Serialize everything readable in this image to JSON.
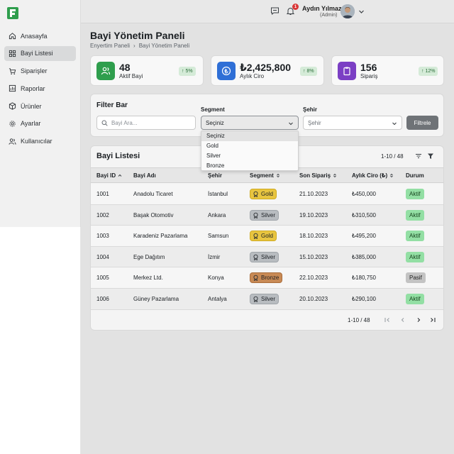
{
  "app": {
    "logo": "brand-logo"
  },
  "sidebar": {
    "items": [
      {
        "label": "Anasayfa",
        "icon": "home-icon"
      },
      {
        "label": "Bayi Listesi",
        "icon": "grid-icon",
        "active": true
      },
      {
        "label": "Siparişler",
        "icon": "cart-icon"
      },
      {
        "label": "Raporlar",
        "icon": "chart-icon"
      },
      {
        "label": "Ürünler",
        "icon": "box-icon"
      },
      {
        "label": "Ayarlar",
        "icon": "gear-icon"
      },
      {
        "label": "Kullanıcılar",
        "icon": "users-icon"
      }
    ]
  },
  "header": {
    "notification_count": "1",
    "user_name": "Aydın Yılmaz",
    "user_role": "(Admin)"
  },
  "page": {
    "title": "Bayi Yönetim Paneli",
    "breadcrumb": [
      "Enyertim Paneli",
      "Bayi Yönetim Paneli"
    ]
  },
  "stats": [
    {
      "value": "48",
      "label": "Aktif Bayi",
      "change": "↑ 5%",
      "color": "#2f9e4d",
      "icon": "users-icon"
    },
    {
      "value": "₺2,425,800",
      "label": "Aylık Ciro",
      "change": "↑ 8%",
      "color": "#2f6fd6",
      "icon": "currency-icon"
    },
    {
      "value": "156",
      "label": "Sipariş",
      "change": "↑ 12%",
      "color": "#7b3fc4",
      "icon": "clipboard-icon"
    }
  ],
  "filter": {
    "title": "Filter Bar",
    "search_placeholder": "Bayi Ara...",
    "segment_label": "Segment",
    "segment_value": "Seçiniz",
    "city_label": "Şehir",
    "city_value": "Şehir",
    "button": "Filtrele",
    "segment_options": [
      "Seçiniz",
      "Gold",
      "Silver",
      "Bronze"
    ]
  },
  "table": {
    "title": "Bayi Listesi",
    "range": "1-10 / 48",
    "columns": [
      "Bayi ID",
      "Bayi Adı",
      "Şehir",
      "Segment",
      "Son Sipariş",
      "Aylık Ciro (₺)",
      "Durum"
    ],
    "rows": [
      {
        "id": "1001",
        "name": "Anadolu Ticaret",
        "city": "İstanbul",
        "segment": "Gold",
        "date": "21.10.2023",
        "revenue": "₺450,000",
        "status": "Aktif"
      },
      {
        "id": "1002",
        "name": "Başak Otomotiv",
        "city": "Ankara",
        "segment": "Silver",
        "date": "19.10.2023",
        "revenue": "₺310,500",
        "status": "Aktif"
      },
      {
        "id": "1003",
        "name": "Karadeniz Pazarlama",
        "city": "Samsun",
        "segment": "Gold",
        "date": "18.10.2023",
        "revenue": "₺495,200",
        "status": "Aktif"
      },
      {
        "id": "1004",
        "name": "Ege Dağıtım",
        "city": "İzmir",
        "segment": "Silver",
        "date": "15.10.2023",
        "revenue": "₺385,000",
        "status": "Aktif"
      },
      {
        "id": "1005",
        "name": "Merkez Ltd.",
        "city": "Konya",
        "segment": "Bronze",
        "date": "22.10.2023",
        "revenue": "₺180,750",
        "status": "Pasif"
      },
      {
        "id": "1006",
        "name": "Güney Pazarlama",
        "city": "Antalya",
        "segment": "Silver",
        "date": "20.10.2023",
        "revenue": "₺290,100",
        "status": "Aktif"
      }
    ],
    "pager_range": "1-10 / 48"
  }
}
